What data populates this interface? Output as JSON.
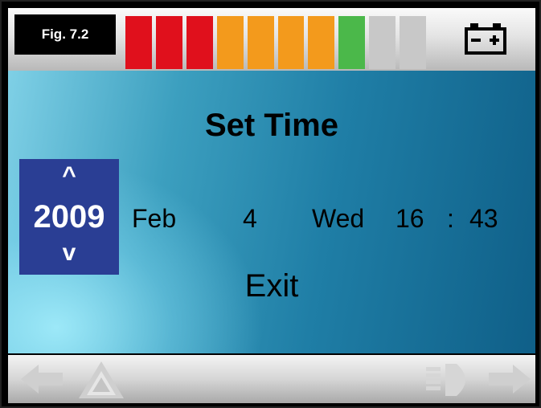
{
  "figure_label": "Fig. 7.2",
  "battery": {
    "segments": [
      "#e0101c",
      "#e0101c",
      "#e0101c",
      "#f39a1c",
      "#f39a1c",
      "#f39a1c",
      "#f39a1c",
      "#4bb84a",
      "#c8c8c8",
      "#c8c8c8"
    ],
    "charged_segments": 8,
    "total_segments": 10,
    "icon": "battery-icon"
  },
  "title": "Set Time",
  "year": {
    "up": "^",
    "value": "2009",
    "down": "v"
  },
  "month": "Feb",
  "day": "4",
  "weekday": "Wed",
  "hour": "16",
  "separator": ":",
  "minute": "43",
  "exit_label": "Exit",
  "bottom_icons": [
    "left-arrow-icon",
    "hazard-icon",
    "headlight-icon",
    "right-arrow-icon"
  ]
}
